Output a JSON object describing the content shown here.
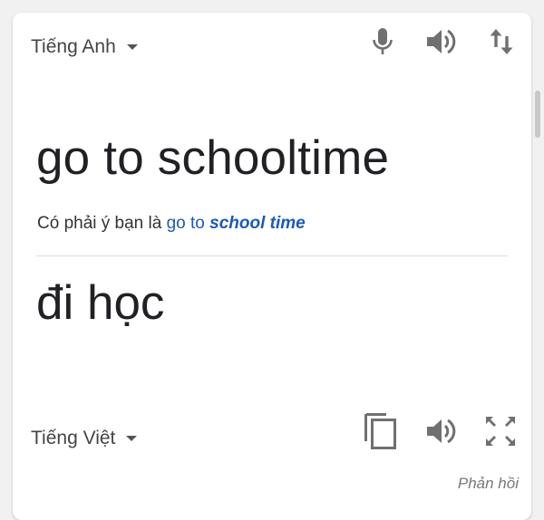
{
  "source": {
    "language": "Tiếng Anh",
    "text": "go to schooltime"
  },
  "suggestion": {
    "prefix": "Có phải ý bạn là",
    "plain": "go to",
    "emphasized": "school time"
  },
  "target": {
    "language": "Tiếng Việt",
    "text": "đi học"
  },
  "icons": {
    "source_tools": [
      "microphone-icon",
      "speaker-icon",
      "swap-icon"
    ],
    "target_tools": [
      "copy-icon",
      "speaker-icon",
      "fullscreen-icon"
    ]
  },
  "footer": {
    "feedback_label": "Phản hồi"
  },
  "colors": {
    "suggestion_link": "#1a5ab8",
    "icon": "#707070",
    "text": "#202124"
  }
}
